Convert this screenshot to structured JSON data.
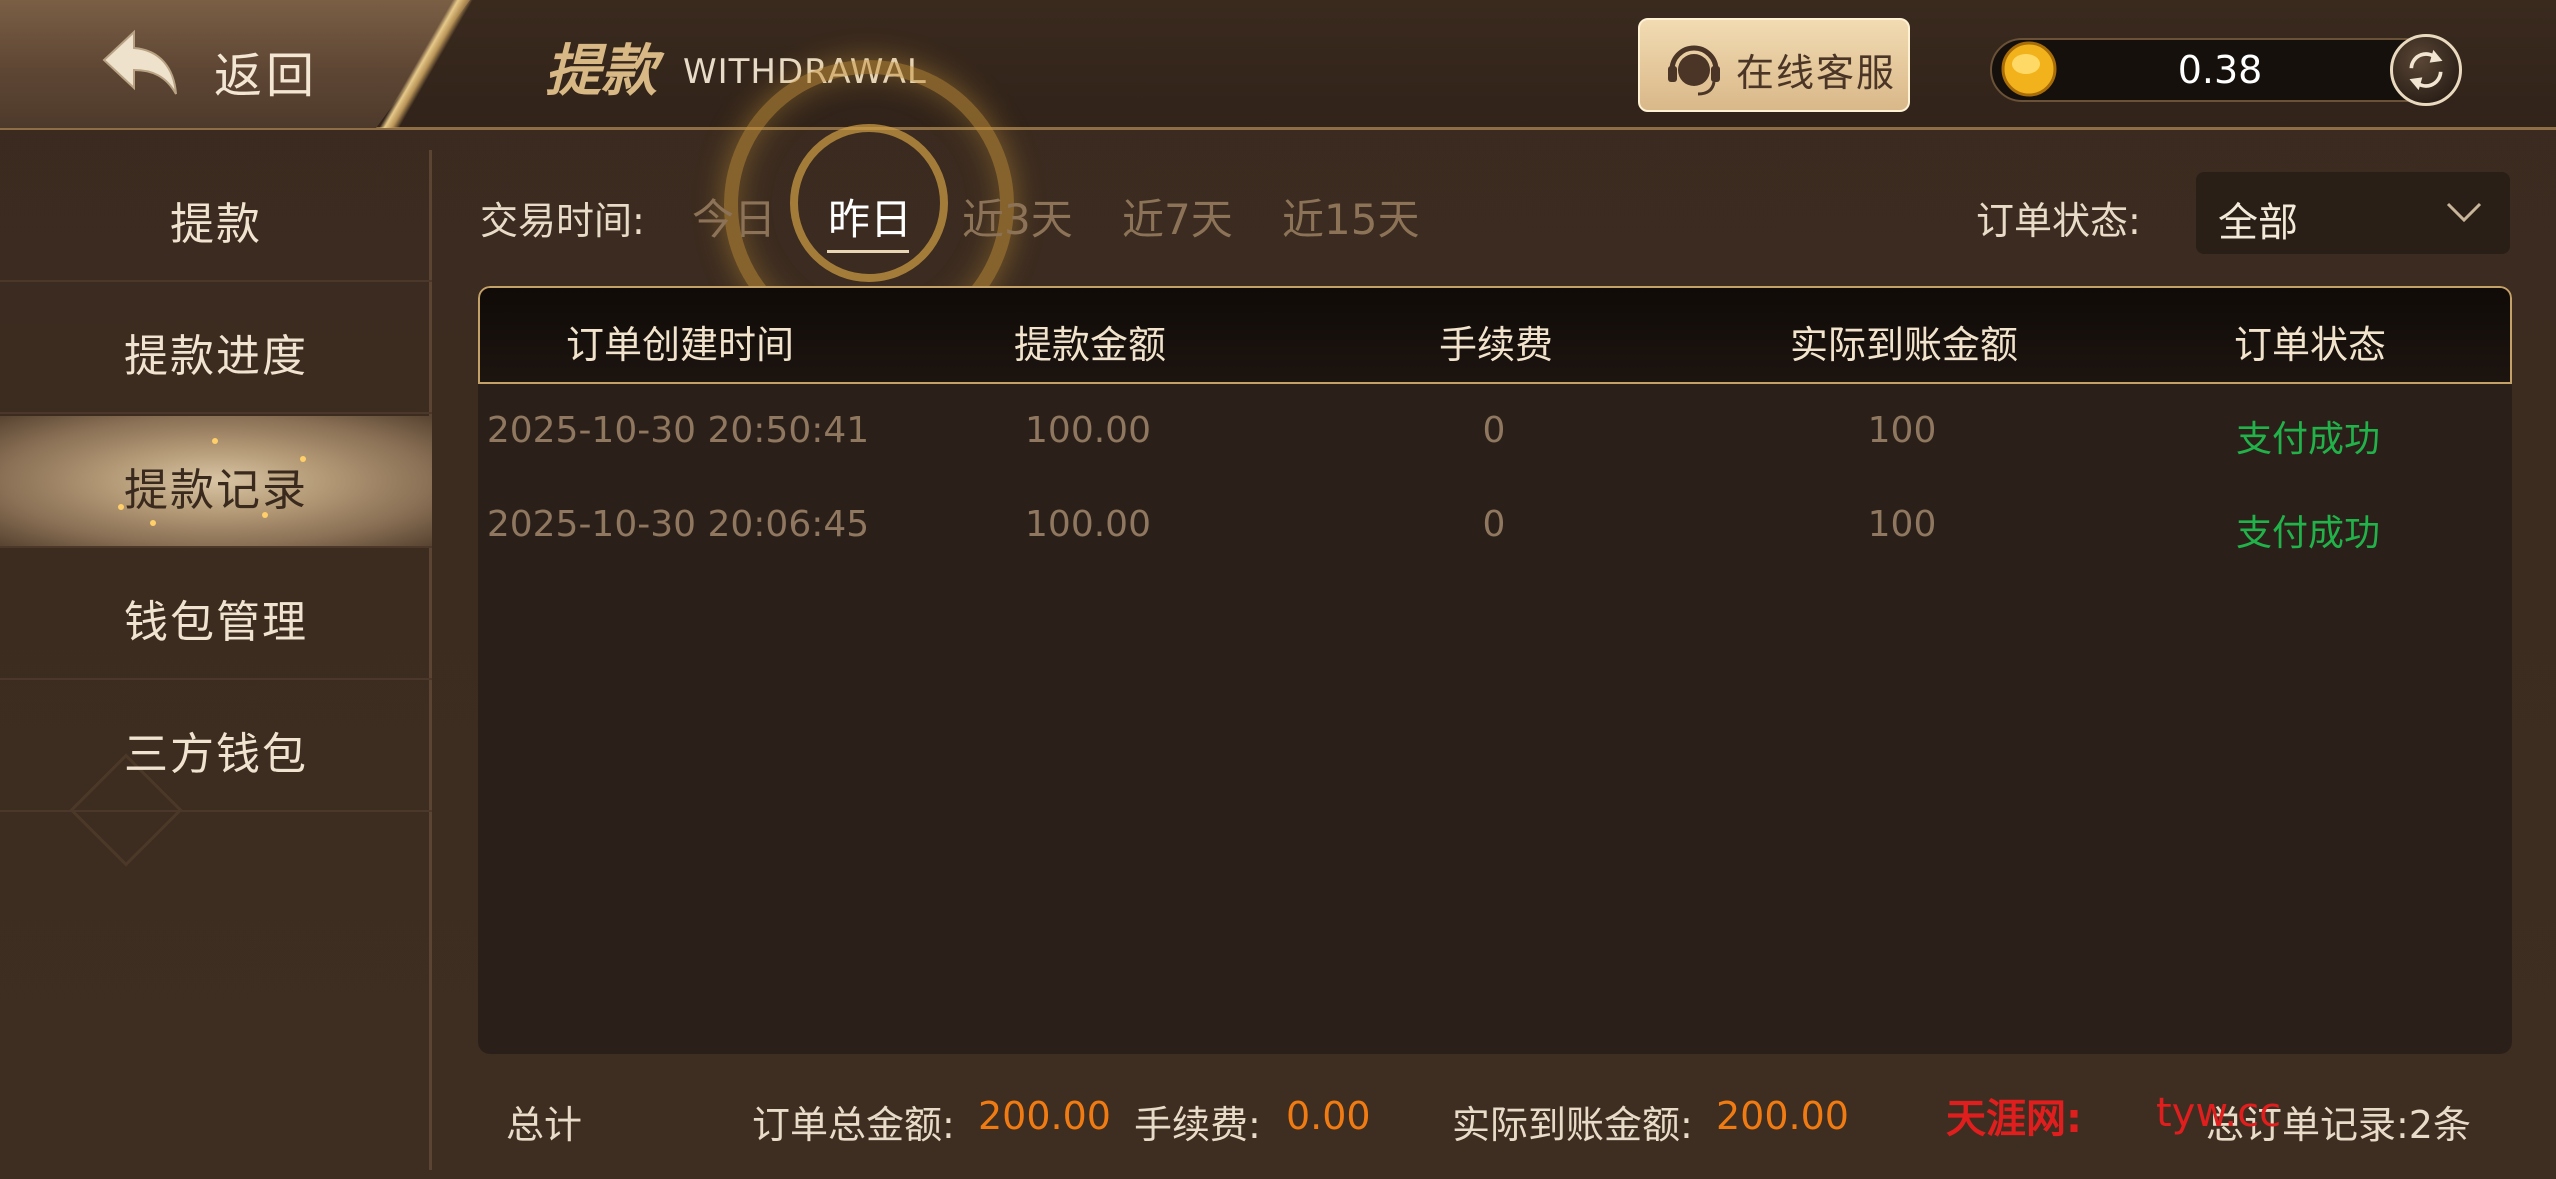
{
  "header": {
    "back_label": "返回",
    "title": "提款",
    "subtitle": "WITHDRAWAL",
    "service_label": "在线客服",
    "balance": "0.38"
  },
  "sidebar": {
    "items": [
      {
        "label": "提款",
        "active": false
      },
      {
        "label": "提款进度",
        "active": false
      },
      {
        "label": "提款记录",
        "active": true
      },
      {
        "label": "钱包管理",
        "active": false
      },
      {
        "label": "三方钱包",
        "active": false
      }
    ]
  },
  "filters": {
    "time_label": "交易时间:",
    "ranges": [
      "今日",
      "昨日",
      "近3天",
      "近7天",
      "近15天"
    ],
    "selected_range": "昨日",
    "status_label": "订单状态:",
    "status_value": "全部"
  },
  "table": {
    "columns": [
      "订单创建时间",
      "提款金额",
      "手续费",
      "实际到账金额",
      "订单状态"
    ],
    "rows": [
      [
        "2025-10-30 20:50:41",
        "100.00",
        "0",
        "100",
        "支付成功"
      ],
      [
        "2025-10-30 20:06:45",
        "100.00",
        "0",
        "100",
        "支付成功"
      ]
    ]
  },
  "footer": {
    "total_label": "总计",
    "order_total_label": "订单总金额:",
    "order_total_value": "200.00",
    "fee_label": "手续费:",
    "fee_value": "0.00",
    "actual_label": "实际到账金额:",
    "actual_value": "200.00",
    "record_text": "总订单记录:2条"
  },
  "watermark": {
    "site": "天涯网:",
    "url": "tyw.cc"
  },
  "colors": {
    "accent_gold": "#c4a166",
    "success_green": "#21b24a",
    "value_orange": "#f07b12",
    "watermark_red": "#e01e1e"
  },
  "icons": [
    "back-arrow-icon",
    "headset-icon",
    "coin-icon",
    "refresh-icon",
    "chevron-down-icon"
  ]
}
